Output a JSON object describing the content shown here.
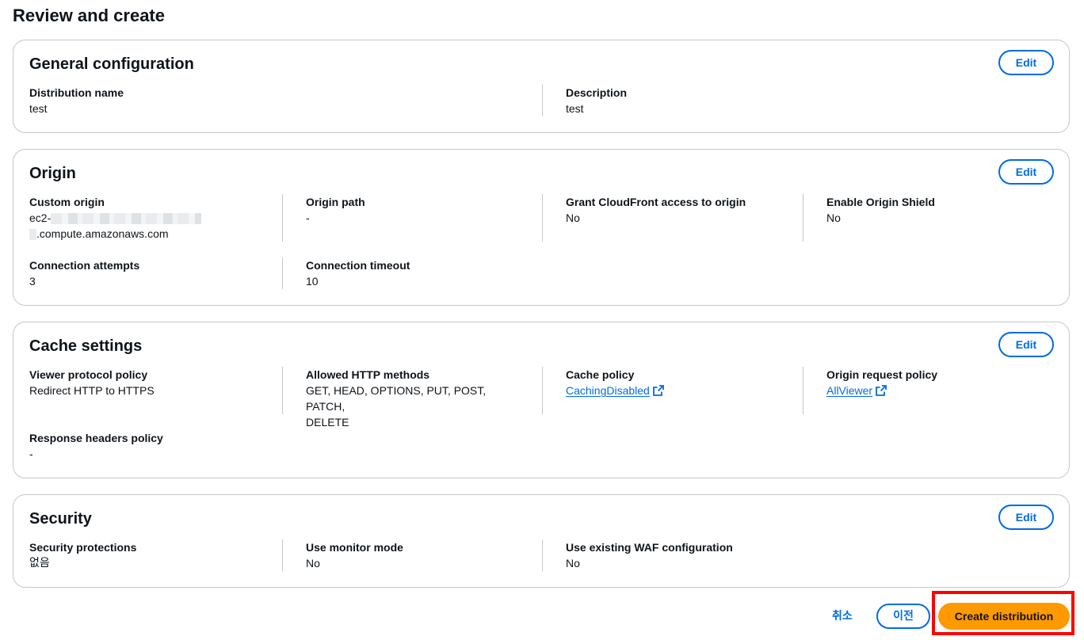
{
  "page": {
    "title": "Review and create"
  },
  "general": {
    "title": "General configuration",
    "edit": "Edit",
    "fields": [
      {
        "label": "Distribution name",
        "value": "test"
      },
      {
        "label": "Description",
        "value": "test"
      }
    ]
  },
  "origin": {
    "title": "Origin",
    "edit": "Edit",
    "custom_origin": {
      "label": "Custom origin",
      "value_line1": "ec2-",
      "value_line2": ".compute.amazonaws.com"
    },
    "origin_path": {
      "label": "Origin path",
      "value": "-"
    },
    "grant_access": {
      "label": "Grant CloudFront access to origin",
      "value": "No"
    },
    "origin_shield": {
      "label": "Enable Origin Shield",
      "value": "No"
    },
    "connection_attempts": {
      "label": "Connection attempts",
      "value": "3"
    },
    "connection_timeout": {
      "label": "Connection timeout",
      "value": "10"
    }
  },
  "cache": {
    "title": "Cache settings",
    "edit": "Edit",
    "viewer_protocol": {
      "label": "Viewer protocol policy",
      "value": "Redirect HTTP to HTTPS"
    },
    "allowed_methods": {
      "label": "Allowed HTTP methods",
      "value_line1": "GET, HEAD, OPTIONS, PUT, POST, PATCH,",
      "value_line2": "DELETE"
    },
    "cache_policy": {
      "label": "Cache policy",
      "value": "CachingDisabled"
    },
    "origin_request_policy": {
      "label": "Origin request policy",
      "value": "AllViewer"
    },
    "response_headers": {
      "label": "Response headers policy",
      "value": "-"
    }
  },
  "security": {
    "title": "Security",
    "edit": "Edit",
    "protections": {
      "label": "Security protections",
      "value": "없음"
    },
    "monitor_mode": {
      "label": "Use monitor mode",
      "value": "No"
    },
    "existing_waf": {
      "label": "Use existing WAF configuration",
      "value": "No"
    }
  },
  "footer": {
    "cancel": "취소",
    "previous": "이전",
    "create": "Create distribution"
  },
  "colors": {
    "accent": "#006ce0",
    "primary_button": "#ff9900",
    "highlight": "#ff0000",
    "border": "#c6c6cd"
  },
  "icons": {
    "external_link": "external-link-icon"
  }
}
